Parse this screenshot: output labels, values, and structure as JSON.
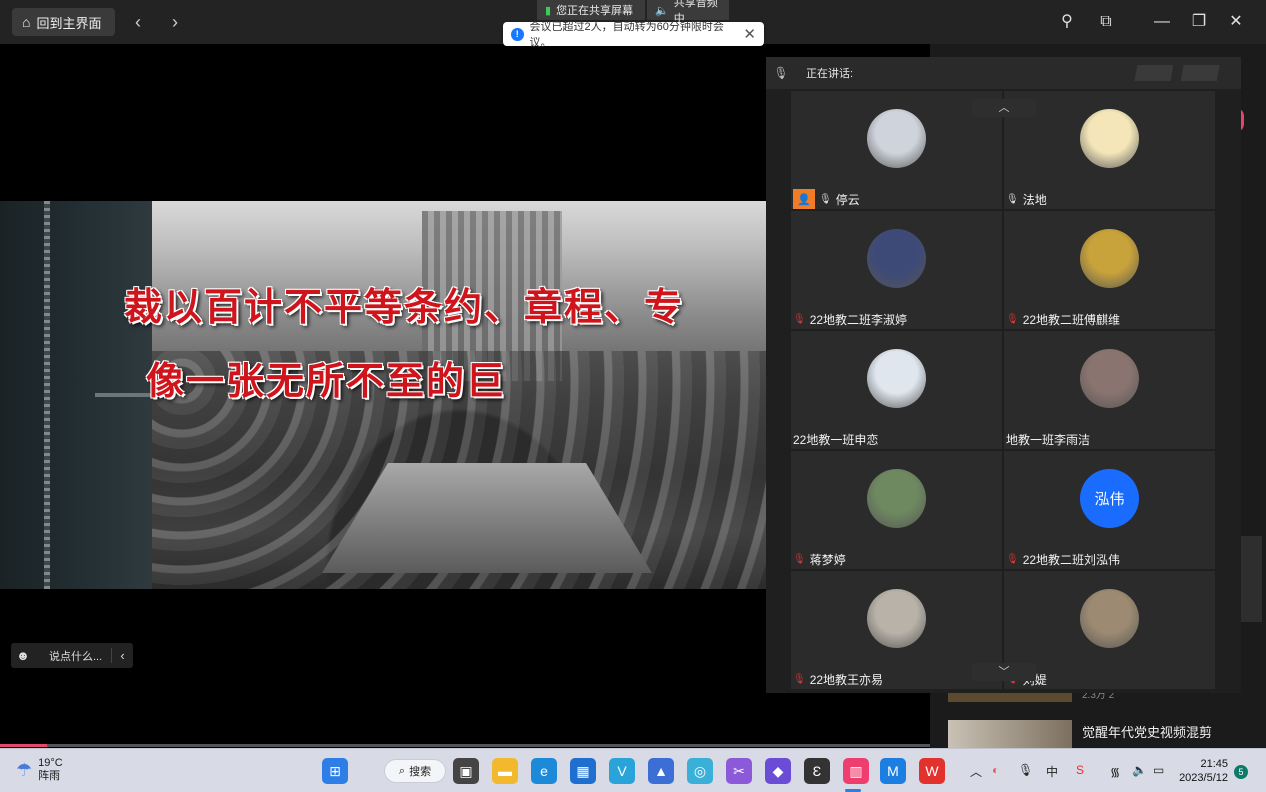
{
  "topbar": {
    "home_label": "回到主界面",
    "back_icon": "chevron-left-icon",
    "forward_icon": "chevron-right-icon",
    "sharing_screen": "您正在共享屏幕",
    "sharing_audio": "共享音频中",
    "notice": "会议已超过2人，自动转为60分钟限时会议。",
    "window_controls": [
      "pin-icon",
      "screen-cast-icon",
      "minimize-icon",
      "restore-icon",
      "close-icon"
    ]
  },
  "slide": {
    "line1": "裁以百计不平等条约、章程、专",
    "line2": "像一张无所不至的巨"
  },
  "chat": {
    "placeholder": "说点什么..."
  },
  "panel": {
    "speaking_label": "正在讲话:",
    "participants": [
      {
        "name": "停云",
        "host": true,
        "mic": "on",
        "avatar": "photo",
        "color": "#cfd4dc"
      },
      {
        "name": "法地",
        "host": false,
        "mic": "on",
        "avatar": "photo",
        "color": "#f4e6b8"
      },
      {
        "name": "22地教二班李淑婷",
        "host": false,
        "mic": "off",
        "avatar": "photo",
        "color": "#3d4a78"
      },
      {
        "name": "22地教二班傅麒维",
        "host": false,
        "mic": "off",
        "avatar": "photo",
        "color": "#c8a23a"
      },
      {
        "name": "22地教一班申恋",
        "host": false,
        "mic": "none",
        "avatar": "photo",
        "color": "#dfe6ee"
      },
      {
        "name": "地教一班李雨洁",
        "host": false,
        "mic": "none",
        "avatar": "photo",
        "color": "#8a7470"
      },
      {
        "name": "蒋梦婷",
        "host": false,
        "mic": "off",
        "avatar": "photo",
        "color": "#6e8860"
      },
      {
        "name": "22地教二班刘泓伟",
        "host": false,
        "mic": "off",
        "avatar": "text",
        "avatar_text": "泓伟",
        "color": "#1a6cff"
      },
      {
        "name": "22地教王亦易",
        "host": false,
        "mic": "off",
        "avatar": "photo",
        "color": "#b8b2a8"
      },
      {
        "name": "刘媞",
        "host": false,
        "mic": "off",
        "avatar": "photo",
        "color": "#9c8a72"
      }
    ]
  },
  "background_page": {
    "video_title": "觉醒年代党史视频混剪",
    "meta": "2.3万  2"
  },
  "taskbar": {
    "weather_temp": "19°C",
    "weather_desc": "阵雨",
    "search_label": "搜索",
    "tray_ime": "中",
    "time": "21:45",
    "date": "2023/5/12",
    "notification_count": "5"
  }
}
